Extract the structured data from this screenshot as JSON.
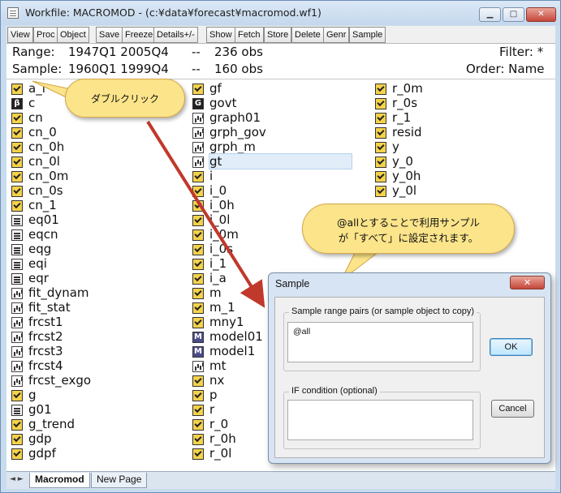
{
  "window": {
    "title": "Workfile: MACROMOD - (c:¥data¥forecast¥macromod.wf1)",
    "min_glyph": "▁",
    "max_glyph": "□",
    "close_glyph": "✕"
  },
  "toolbar": [
    "View",
    "Proc",
    "Object",
    "Save",
    "Freeze",
    "Details+/-",
    "Show",
    "Fetch",
    "Store",
    "Delete",
    "Genr",
    "Sample"
  ],
  "info": {
    "range_label": "Range:",
    "range_value": "1947Q1 2005Q4",
    "range_dash": "--",
    "range_obs": "236 obs",
    "sample_label": "Sample:",
    "sample_value": "1960Q1 1999Q4",
    "sample_dash": "--",
    "sample_obs": "160 obs",
    "filter": "Filter: *",
    "order": "Order: Name"
  },
  "objects": {
    "col1": [
      {
        "name": "a_i",
        "type": "series"
      },
      {
        "name": "c",
        "type": "coef",
        "glyph": "β"
      },
      {
        "name": "cn",
        "type": "series"
      },
      {
        "name": "cn_0",
        "type": "series"
      },
      {
        "name": "cn_0h",
        "type": "series"
      },
      {
        "name": "cn_0l",
        "type": "series"
      },
      {
        "name": "cn_0m",
        "type": "series"
      },
      {
        "name": "cn_0s",
        "type": "series"
      },
      {
        "name": "cn_1",
        "type": "series"
      },
      {
        "name": "eq01",
        "type": "eq"
      },
      {
        "name": "eqcn",
        "type": "eq"
      },
      {
        "name": "eqg",
        "type": "eq"
      },
      {
        "name": "eqi",
        "type": "eq"
      },
      {
        "name": "eqr",
        "type": "eq"
      },
      {
        "name": "fit_dynam",
        "type": "graph"
      },
      {
        "name": "fit_stat",
        "type": "graph"
      },
      {
        "name": "frcst1",
        "type": "graph"
      },
      {
        "name": "frcst2",
        "type": "graph"
      },
      {
        "name": "frcst3",
        "type": "graph"
      },
      {
        "name": "frcst4",
        "type": "graph"
      },
      {
        "name": "frcst_exgo",
        "type": "graph"
      },
      {
        "name": "g",
        "type": "series"
      },
      {
        "name": "g01",
        "type": "eq"
      },
      {
        "name": "g_trend",
        "type": "series"
      },
      {
        "name": "gdp",
        "type": "series"
      },
      {
        "name": "gdpf",
        "type": "series"
      }
    ],
    "col2": [
      {
        "name": "gf",
        "type": "series"
      },
      {
        "name": "govt",
        "type": "scalar",
        "glyph": "G"
      },
      {
        "name": "graph01",
        "type": "graph"
      },
      {
        "name": "grph_gov",
        "type": "graph"
      },
      {
        "name": "grph_m",
        "type": "graph"
      },
      {
        "name": "gt",
        "type": "graph"
      },
      {
        "name": "i",
        "type": "series"
      },
      {
        "name": "i_0",
        "type": "series"
      },
      {
        "name": "i_0h",
        "type": "series"
      },
      {
        "name": "i_0l",
        "type": "series"
      },
      {
        "name": "i_0m",
        "type": "series"
      },
      {
        "name": "i_0s",
        "type": "series"
      },
      {
        "name": "i_1",
        "type": "series"
      },
      {
        "name": "i_a",
        "type": "series"
      },
      {
        "name": "m",
        "type": "series"
      },
      {
        "name": "m_1",
        "type": "series"
      },
      {
        "name": "mny1",
        "type": "series"
      },
      {
        "name": "model01",
        "type": "model",
        "glyph": "M"
      },
      {
        "name": "model1",
        "type": "model",
        "glyph": "M"
      },
      {
        "name": "mt",
        "type": "graph"
      },
      {
        "name": "nx",
        "type": "series"
      },
      {
        "name": "p",
        "type": "series"
      },
      {
        "name": "r",
        "type": "series"
      },
      {
        "name": "r_0",
        "type": "series"
      },
      {
        "name": "r_0h",
        "type": "series"
      },
      {
        "name": "r_0l",
        "type": "series"
      }
    ],
    "col3": [
      {
        "name": "r_0m",
        "type": "series"
      },
      {
        "name": "r_0s",
        "type": "series"
      },
      {
        "name": "r_1",
        "type": "series"
      },
      {
        "name": "resid",
        "type": "series"
      },
      {
        "name": "y",
        "type": "series"
      },
      {
        "name": "y_0",
        "type": "series"
      },
      {
        "name": "y_0h",
        "type": "series"
      },
      {
        "name": "y_0l",
        "type": "series"
      }
    ]
  },
  "tabs": {
    "arrows": "◄ ►",
    "active": "Macromod",
    "new_page": "New Page"
  },
  "callouts": {
    "double_click": "ダブルクリック",
    "note_line1": "@allとすることで利用サンプル",
    "note_line2": "が「すべて」に設定されます。"
  },
  "dialog": {
    "title": "Sample",
    "close_glyph": "✕",
    "range_group": "Sample range pairs (or sample object to copy)",
    "range_value": "@all",
    "if_group": "IF condition (optional)",
    "if_value": "",
    "ok": "OK",
    "cancel": "Cancel"
  },
  "colors": {
    "callout_fill": "#fbe48a",
    "arrow": "#c0392b",
    "series_icon": "#f4d24a"
  }
}
